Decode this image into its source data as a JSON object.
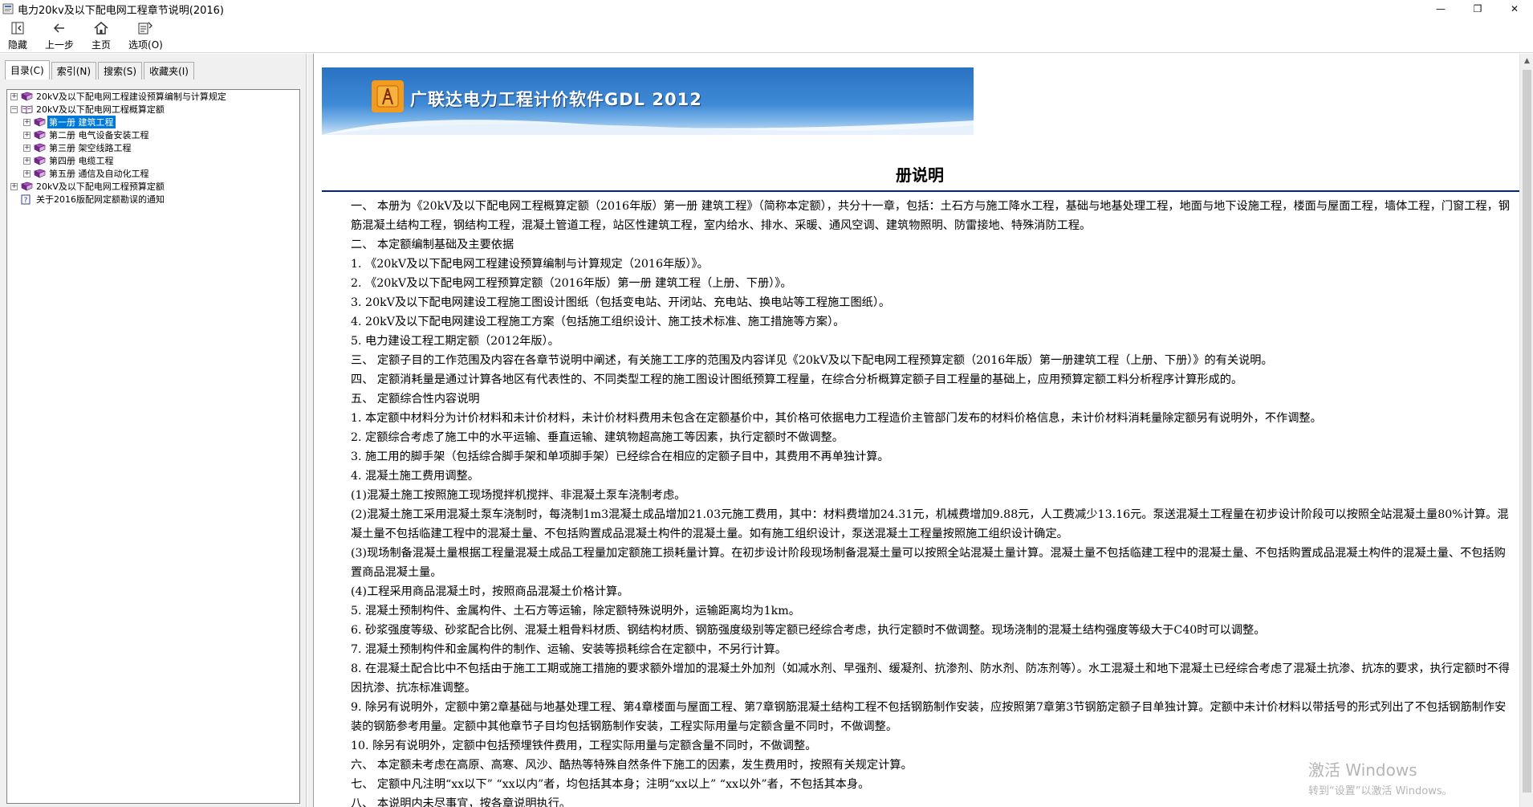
{
  "window": {
    "title": "电力20kv及以下配电网工程章节说明(2016)",
    "controls": [
      "—",
      "❐",
      "✕"
    ]
  },
  "toolbar": {
    "buttons": [
      {
        "label": "隐藏",
        "icon": "hide-icon"
      },
      {
        "label": "上一步",
        "icon": "back-arrow-icon"
      },
      {
        "label": "主页",
        "icon": "home-icon"
      },
      {
        "label": "选项(O)",
        "icon": "options-icon"
      }
    ]
  },
  "nav": {
    "tabs": [
      "目录(C)",
      "索引(N)",
      "搜索(S)",
      "收藏夹(I)"
    ],
    "active_tab": "目录(C)",
    "tree": [
      {
        "expander": "+",
        "icon": "book-closed-icon",
        "label": "20kV及以下配电网工程建设预算编制与计算规定",
        "level": 0
      },
      {
        "expander": "−",
        "icon": "book-open-icon",
        "label": "20kV及以下配电网工程概算定额",
        "level": 0
      },
      {
        "expander": "+",
        "icon": "book-closed-icon",
        "label": "第一册 建筑工程",
        "level": 1,
        "selected": true
      },
      {
        "expander": "+",
        "icon": "book-closed-icon",
        "label": "第二册 电气设备安装工程",
        "level": 1
      },
      {
        "expander": "+",
        "icon": "book-closed-icon",
        "label": "第三册 架空线路工程",
        "level": 1
      },
      {
        "expander": "+",
        "icon": "book-closed-icon",
        "label": "第四册 电缆工程",
        "level": 1
      },
      {
        "expander": "+",
        "icon": "book-closed-icon",
        "label": "第五册 通信及自动化工程",
        "level": 1
      },
      {
        "expander": "+",
        "icon": "book-closed-icon",
        "label": "20kV及以下配电网工程预算定额",
        "level": 0
      },
      {
        "expander": "",
        "icon": "help-page-icon",
        "label": "关于2016版配网定额勘误的通知",
        "level": 0
      }
    ]
  },
  "banner": {
    "title": "广联达电力工程计价软件GDL 2012"
  },
  "document": {
    "title": "册说明",
    "paragraphs": [
      "一、 本册为《20kV及以下配电网工程概算定额（2016年版）第一册 建筑工程》（简称本定额），共分十一章，包括：土石方与施工降水工程，基础与地基处理工程，地面与地下设施工程，楼面与屋面工程，墙体工程，门窗工程，钢筋混凝土结构工程，钢结构工程，混凝土管道工程，站区性建筑工程，室内给水、排水、采暖、通风空调、建筑物照明、防雷接地、特殊消防工程。",
      "二、 本定额编制基础及主要依据",
      "1. 《20kV及以下配电网工程建设预算编制与计算规定（2016年版）》。",
      "2. 《20kV及以下配电网工程预算定额（2016年版）第一册 建筑工程（上册、下册）》。",
      "3. 20kV及以下配电网建设工程施工图设计图纸（包括变电站、开闭站、充电站、换电站等工程施工图纸）。",
      "4. 20kV及以下配电网建设工程施工方案（包括施工组织设计、施工技术标准、施工措施等方案）。",
      "5. 电力建设工程工期定额（2012年版）。",
      "三、 定额子目的工作范围及内容在各章节说明中阐述，有关施工工序的范围及内容详见《20kV及以下配电网工程预算定额（2016年版）第一册建筑工程（上册、下册）》的有关说明。",
      "四、 定额消耗量是通过计算各地区有代表性的、不同类型工程的施工图设计图纸预算工程量，在综合分析概算定额子目工程量的基础上，应用预算定额工料分析程序计算形成的。",
      "五、 定额综合性内容说明",
      "1. 本定额中材料分为计价材料和未计价材料，未计价材料费用未包含在定额基价中，其价格可依据电力工程造价主管部门发布的材料价格信息，未计价材料消耗量除定额另有说明外，不作调整。",
      "2. 定额综合考虑了施工中的水平运输、垂直运输、建筑物超高施工等因素，执行定额时不做调整。",
      "3. 施工用的脚手架（包括综合脚手架和单项脚手架）已经综合在相应的定额子目中，其费用不再单独计算。",
      "4. 混凝土施工费用调整。",
      "(1)混凝土施工按照施工现场搅拌机搅拌、非混凝土泵车浇制考虑。",
      "(2)混凝土施工采用混凝土泵车浇制时，每浇制1m3混凝土成品增加21.03元施工费用，其中：材料费增加24.31元，机械费增加9.88元，人工费减少13.16元。泵送混凝土工程量在初步设计阶段可以按照全站混凝土量80%计算。混凝土量不包括临建工程中的混凝土量、不包括购置成品混凝土构件的混凝土量。如有施工组织设计，泵送混凝土工程量按照施工组织设计确定。",
      "(3)现场制备混凝土量根据工程量混凝土成品工程量加定额施工损耗量计算。在初步设计阶段现场制备混凝土量可以按照全站混凝土量计算。混凝土量不包括临建工程中的混凝土量、不包括购置成品混凝土构件的混凝土量、不包括购置商品混凝土量。",
      "(4)工程采用商品混凝土时，按照商品混凝土价格计算。",
      "5. 混凝土预制构件、金属构件、土石方等运输，除定额特殊说明外，运输距离均为1km。",
      "6. 砂浆强度等级、砂浆配合比例、混凝土粗骨料材质、钢结构材质、钢筋强度级别等定额已经综合考虑，执行定额时不做调整。现场浇制的混凝土结构强度等级大于C40时可以调整。",
      "7. 混凝土预制构件和金属构件的制作、运输、安装等损耗综合在定额中，不另行计算。",
      "8. 在混凝土配合比中不包括由于施工工期或施工措施的要求额外增加的混凝土外加剂（如减水剂、早强剂、缓凝剂、抗渗剂、防水剂、防冻剂等）。水工混凝土和地下混凝土已经综合考虑了混凝土抗渗、抗冻的要求，执行定额时不得因抗渗、抗冻标准调整。",
      "9. 除另有说明外，定额中第2章基础与地基处理工程、第4章楼面与屋面工程、第7章钢筋混凝土结构工程不包括钢筋制作安装，应按照第7章第3节钢筋定额子目单独计算。定额中未计价材料以带括号的形式列出了不包括钢筋制作安装的钢筋参考用量。定额中其他章节子目均包括钢筋制作安装，工程实际用量与定额含量不同时，不做调整。",
      "10. 除另有说明外，定额中包括预埋铁件费用，工程实际用量与定额含量不同时，不做调整。",
      "六、 本定额未考虑在高原、高寒、风沙、酷热等特殊自然条件下施工的因素，发生费用时，按照有关规定计算。",
      "七、 定额中凡注明“xx以下” “xx以内”者，均包括其本身；注明“xx以上” “xx以外”者，不包括其本身。",
      "八、 本说明内未尽事宜，按各章说明执行。"
    ]
  },
  "watermark": {
    "line1": "激活 Windows",
    "line2": "转到“设置”以激活 Windows。"
  },
  "colors": {
    "selection": "#0078d7",
    "banner": "#3f8ad6",
    "rule": "#00238c"
  }
}
